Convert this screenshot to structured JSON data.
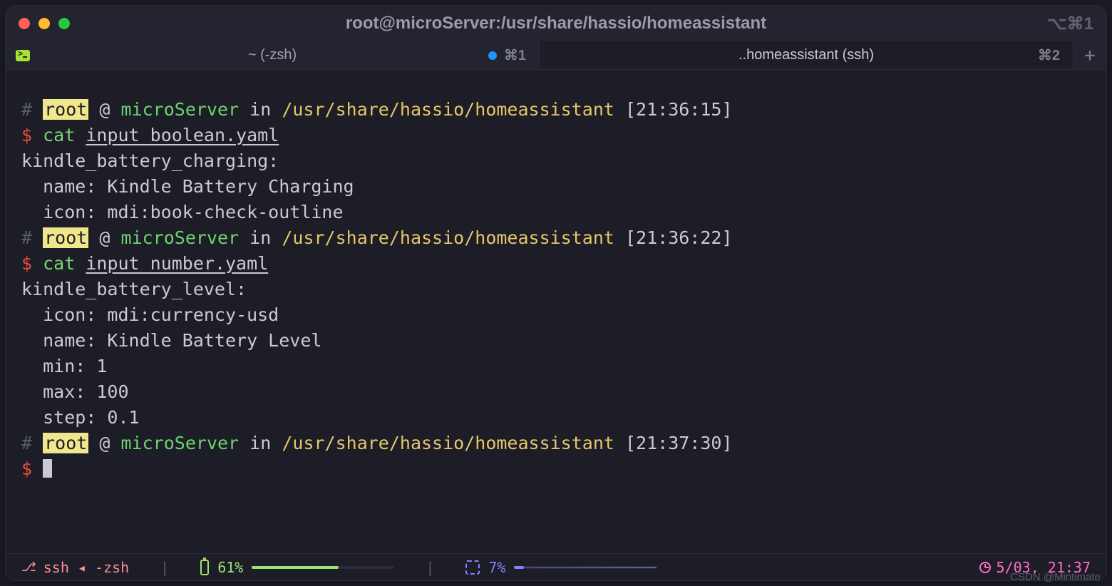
{
  "title": "root@microServer:/usr/share/hassio/homeassistant",
  "title_right_shortcut": "⌘1",
  "tabs": [
    {
      "label": "~ (-zsh)",
      "shortcut": "⌘1",
      "dirty": true,
      "active": false
    },
    {
      "label": "..homeassistant (ssh)",
      "shortcut": "⌘2",
      "dirty": false,
      "active": true
    }
  ],
  "session": {
    "user": "root",
    "host": "microServer",
    "path": "/usr/share/hassio/homeassistant"
  },
  "blocks": [
    {
      "time": "21:36:15",
      "cmd": "cat",
      "arg": "input_boolean.yaml",
      "output": [
        "kindle_battery_charging:",
        "  name: Kindle Battery Charging",
        "  icon: mdi:book-check-outline",
        ""
      ]
    },
    {
      "time": "21:36:22",
      "cmd": "cat",
      "arg": "input_number.yaml",
      "output": [
        "kindle_battery_level:",
        "  icon: mdi:currency-usd",
        "  name: Kindle Battery Level",
        "  min: 1",
        "  max: 100",
        "  step: 0.1",
        ""
      ]
    },
    {
      "time": "21:37:30",
      "cmd": "",
      "arg": "",
      "output": [],
      "cursor": true
    }
  ],
  "status": {
    "proc": "ssh ◂ -zsh",
    "battery": "61%",
    "cpu": "7%",
    "clock": "5/03, 21:37"
  },
  "watermark": "CSDN @Mintimate",
  "glyphs": {
    "hash": "#",
    "at": "@",
    "in": "in",
    "dollar": "$",
    "opt_cmd": "⌥⌘1",
    "plus": "+"
  }
}
